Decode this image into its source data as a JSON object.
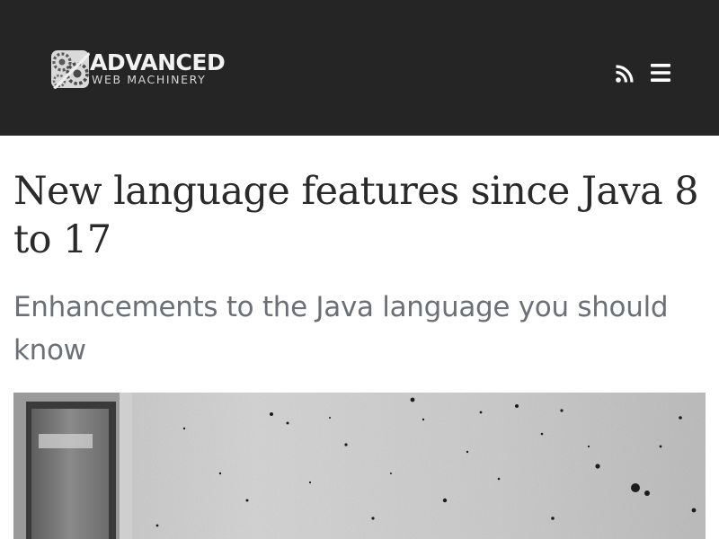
{
  "header": {
    "logo": {
      "title": "ADVANCED",
      "subtitle": "WEB MACHINERY",
      "icon": "gears-logo-icon"
    },
    "rss": {
      "icon": "rss-icon"
    },
    "menu": {
      "icon": "hamburger-menu-icon"
    },
    "background_color": "#252525"
  },
  "article": {
    "title": "New language features since Java 8 to 17",
    "subtitle": "Enhancements to the Java language you should know",
    "hero_image": {
      "kind": "grayscale-photo-speckled-concrete-wall"
    }
  },
  "colors": {
    "title_text": "#2a2a2a",
    "subtitle_text": "#6b7076",
    "header_icons": "#ffffff"
  }
}
